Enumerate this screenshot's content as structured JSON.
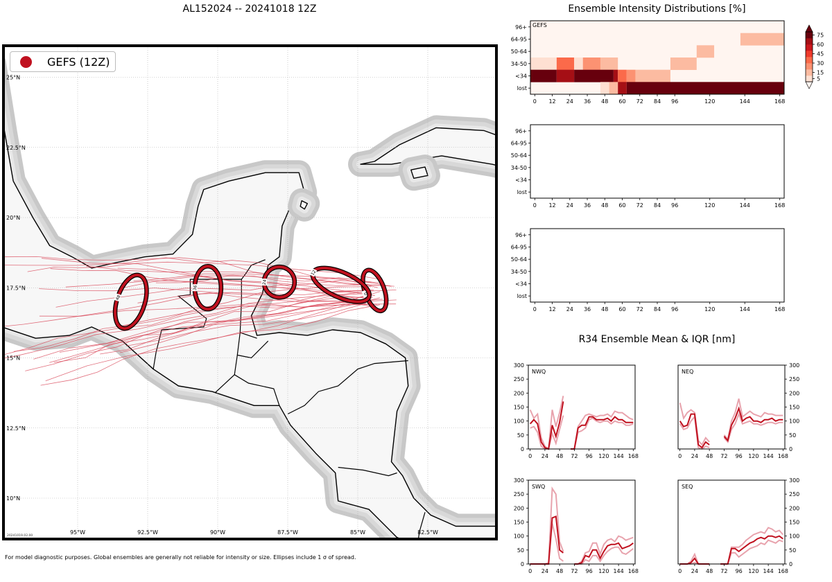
{
  "titles": {
    "main": "AL152024 -- 20241018 12Z",
    "heatmap": "Ensemble Intensity Distributions [%]",
    "r34": "R34 Ensemble Mean & IQR [nm]"
  },
  "legend": {
    "label": "GEFS (12Z)",
    "marker_color": "#c0111f"
  },
  "map": {
    "lat_labels": [
      "25°N",
      "22.5°N",
      "20°N",
      "17.5°N",
      "15°N",
      "12.5°N",
      "10°N"
    ],
    "lon_labels": [
      "95°W",
      "92.5°W",
      "90°W",
      "87.5°W",
      "85°W",
      "82.5°W"
    ],
    "timestamp_stamp": "20241019.02.00",
    "ellipses": [
      {
        "hour": "0",
        "lon": -84.4,
        "lat": 17.4
      },
      {
        "hour": "12",
        "lon": -85.6,
        "lat": 17.6
      },
      {
        "hour": "24",
        "lon": -87.8,
        "lat": 17.7
      },
      {
        "hour": "36",
        "lon": -90.35,
        "lat": 17.5
      },
      {
        "hour": "48",
        "lon": -93.1,
        "lat": 17.0
      }
    ]
  },
  "colorbar": {
    "ticks": [
      "75",
      "60",
      "45",
      "30",
      "15",
      "5"
    ],
    "colors": [
      "#fff5f0",
      "#fee0d2",
      "#fcbba1",
      "#fc9272",
      "#fb6a4a",
      "#ef3b2c",
      "#cb181d",
      "#a50f15",
      "#67000d"
    ]
  },
  "footer": "For model diagnostic purposes. Global ensembles are generally not reliable for intensity or size. Ellipses include 1 σ of spread.",
  "chart_data": [
    {
      "type": "heatmap",
      "panel_label": "GEFS",
      "y_categories": [
        "96+",
        "64-95",
        "50-64",
        "34-50",
        "<34",
        "lost"
      ],
      "x_ticks": [
        0,
        12,
        24,
        36,
        48,
        60,
        72,
        84,
        96,
        120,
        144,
        168
      ],
      "x_range": [
        -3,
        171
      ],
      "cells": [
        {
          "row": "64-95",
          "x0": 141,
          "x1": 171,
          "value": 15
        },
        {
          "row": "50-64",
          "x0": 111,
          "x1": 123,
          "value": 15
        },
        {
          "row": "34-50",
          "x0": -3,
          "x1": 15,
          "value": 5
        },
        {
          "row": "34-50",
          "x0": 15,
          "x1": 27,
          "value": 45
        },
        {
          "row": "34-50",
          "x0": 27,
          "x1": 33,
          "value": 5
        },
        {
          "row": "34-50",
          "x0": 33,
          "x1": 45,
          "value": 30
        },
        {
          "row": "34-50",
          "x0": 45,
          "x1": 57,
          "value": 15
        },
        {
          "row": "34-50",
          "x0": 93,
          "x1": 111,
          "value": 15
        },
        {
          "row": "<34",
          "x0": -3,
          "x1": 15,
          "value": 90
        },
        {
          "row": "<34",
          "x0": 15,
          "x1": 27,
          "value": 75
        },
        {
          "row": "<34",
          "x0": 27,
          "x1": 54,
          "value": 90
        },
        {
          "row": "<34",
          "x0": 54,
          "x1": 57,
          "value": 75
        },
        {
          "row": "<34",
          "x0": 57,
          "x1": 63,
          "value": 45
        },
        {
          "row": "<34",
          "x0": 63,
          "x1": 69,
          "value": 30
        },
        {
          "row": "<34",
          "x0": 69,
          "x1": 93,
          "value": 15
        },
        {
          "row": "lost",
          "x0": 45,
          "x1": 51,
          "value": 5
        },
        {
          "row": "lost",
          "x0": 51,
          "x1": 57,
          "value": 15
        },
        {
          "row": "lost",
          "x0": 57,
          "x1": 63,
          "value": 75
        },
        {
          "row": "lost",
          "x0": 63,
          "x1": 171,
          "value": 90
        }
      ]
    },
    {
      "type": "heatmap",
      "panel_label": "",
      "y_categories": [
        "96+",
        "64-95",
        "50-64",
        "34-50",
        "<34",
        "lost"
      ],
      "x_ticks": [
        0,
        12,
        24,
        36,
        48,
        60,
        72,
        84,
        96,
        120,
        144,
        168
      ],
      "x_range": [
        -3,
        171
      ],
      "cells": []
    },
    {
      "type": "heatmap",
      "panel_label": "",
      "y_categories": [
        "96+",
        "64-95",
        "50-64",
        "34-50",
        "<34",
        "lost"
      ],
      "x_ticks": [
        0,
        12,
        24,
        36,
        48,
        60,
        72,
        84,
        96,
        120,
        144,
        168
      ],
      "x_range": [
        -3,
        171
      ],
      "cells": []
    },
    {
      "type": "line",
      "quadrant": "NWQ",
      "xlim": [
        -3,
        171
      ],
      "ylim": [
        0,
        300
      ],
      "x_ticks": [
        0,
        24,
        48,
        72,
        96,
        120,
        144,
        168
      ],
      "y_ticks": [
        0,
        50,
        100,
        150,
        200,
        250,
        300
      ],
      "segments": [
        {
          "x": [
            0,
            6,
            12,
            18,
            24,
            30,
            36,
            42,
            48,
            54
          ],
          "mean": [
            90,
            105,
            90,
            25,
            5,
            0,
            85,
            45,
            95,
            170
          ],
          "q1": [
            75,
            80,
            60,
            10,
            0,
            0,
            55,
            20,
            70,
            120
          ],
          "q3": [
            140,
            110,
            125,
            40,
            10,
            0,
            140,
            80,
            130,
            190
          ]
        },
        {
          "x": [
            66,
            72,
            78,
            84,
            90,
            96,
            102,
            108,
            114,
            120,
            126,
            132,
            138,
            144,
            150,
            156,
            162,
            168
          ],
          "mean": [
            0,
            0,
            75,
            85,
            85,
            115,
            115,
            105,
            105,
            105,
            110,
            100,
            115,
            105,
            105,
            95,
            95,
            95
          ],
          "q1": [
            0,
            0,
            60,
            65,
            75,
            105,
            110,
            100,
            95,
            100,
            100,
            90,
            100,
            95,
            95,
            85,
            85,
            90
          ],
          "q3": [
            0,
            0,
            80,
            100,
            120,
            125,
            120,
            115,
            120,
            120,
            125,
            115,
            135,
            130,
            130,
            120,
            110,
            105
          ]
        }
      ]
    },
    {
      "type": "line",
      "quadrant": "NEQ",
      "xlim": [
        -3,
        171
      ],
      "ylim": [
        0,
        300
      ],
      "x_ticks": [
        0,
        24,
        48,
        72,
        96,
        120,
        144,
        168
      ],
      "y_ticks": [
        0,
        50,
        100,
        150,
        200,
        250,
        300
      ],
      "segments": [
        {
          "x": [
            0,
            6,
            12,
            18,
            24,
            30,
            36,
            42,
            48
          ],
          "mean": [
            100,
            80,
            85,
            125,
            125,
            15,
            5,
            25,
            15
          ],
          "q1": [
            90,
            70,
            75,
            100,
            115,
            5,
            0,
            10,
            5
          ],
          "q3": [
            165,
            110,
            130,
            140,
            130,
            30,
            15,
            40,
            25
          ]
        },
        {
          "x": [
            72,
            78,
            84,
            90,
            96,
            102,
            108,
            114,
            120,
            126,
            132,
            138,
            144,
            150,
            156,
            162,
            168
          ],
          "mean": [
            45,
            30,
            85,
            110,
            145,
            100,
            110,
            115,
            100,
            100,
            95,
            105,
            105,
            110,
            100,
            105,
            105
          ],
          "q1": [
            40,
            25,
            70,
            90,
            125,
            90,
            95,
            100,
            90,
            90,
            85,
            90,
            95,
            95,
            90,
            95,
            95
          ],
          "q3": [
            50,
            35,
            100,
            130,
            180,
            115,
            125,
            135,
            125,
            120,
            115,
            130,
            125,
            125,
            120,
            120,
            120
          ]
        }
      ]
    },
    {
      "type": "line",
      "quadrant": "SWQ",
      "xlim": [
        -3,
        171
      ],
      "ylim": [
        0,
        300
      ],
      "x_ticks": [
        0,
        24,
        48,
        72,
        96,
        120,
        144,
        168
      ],
      "y_ticks": [
        0,
        50,
        100,
        150,
        200,
        250,
        300
      ],
      "segments": [
        {
          "x": [
            0,
            6,
            12,
            18,
            24,
            30,
            36,
            42,
            48,
            54
          ],
          "mean": [
            0,
            0,
            0,
            0,
            0,
            0,
            165,
            170,
            50,
            40
          ],
          "q1": [
            0,
            0,
            0,
            0,
            0,
            0,
            145,
            90,
            20,
            10
          ],
          "q3": [
            0,
            0,
            0,
            0,
            0,
            5,
            270,
            250,
            80,
            45
          ]
        },
        {
          "x": [
            72,
            78,
            84,
            90,
            96,
            102,
            108,
            114,
            120,
            126,
            132,
            138,
            144,
            150,
            156,
            162,
            168
          ],
          "mean": [
            0,
            0,
            5,
            30,
            25,
            50,
            50,
            20,
            45,
            65,
            70,
            70,
            75,
            55,
            60,
            65,
            75
          ],
          "q1": [
            0,
            0,
            0,
            15,
            10,
            30,
            30,
            10,
            30,
            45,
            55,
            60,
            60,
            40,
            35,
            45,
            55
          ],
          "q3": [
            0,
            0,
            10,
            40,
            45,
            75,
            75,
            35,
            70,
            85,
            90,
            80,
            100,
            95,
            85,
            90,
            95
          ]
        }
      ]
    },
    {
      "type": "line",
      "quadrant": "SEQ",
      "xlim": [
        -3,
        171
      ],
      "ylim": [
        0,
        300
      ],
      "x_ticks": [
        0,
        24,
        48,
        72,
        96,
        120,
        144,
        168
      ],
      "y_ticks": [
        0,
        50,
        100,
        150,
        200,
        250,
        300
      ],
      "segments": [
        {
          "x": [
            0,
            6,
            12,
            18,
            24,
            30,
            36,
            42,
            48
          ],
          "mean": [
            0,
            0,
            0,
            5,
            20,
            0,
            0,
            0,
            0
          ],
          "q1": [
            0,
            0,
            0,
            0,
            5,
            0,
            0,
            0,
            0
          ],
          "q3": [
            0,
            0,
            0,
            10,
            35,
            0,
            0,
            0,
            0
          ]
        },
        {
          "x": [
            66,
            72,
            78,
            84,
            90,
            96,
            102,
            108,
            114,
            120,
            126,
            132,
            138,
            144,
            150,
            156,
            162,
            168
          ],
          "mean": [
            0,
            0,
            0,
            55,
            55,
            45,
            55,
            65,
            75,
            80,
            90,
            95,
            90,
            100,
            100,
            95,
            100,
            90
          ],
          "q1": [
            0,
            0,
            0,
            40,
            40,
            25,
            35,
            45,
            55,
            60,
            65,
            75,
            70,
            85,
            80,
            75,
            85,
            80
          ],
          "q3": [
            0,
            0,
            0,
            60,
            60,
            60,
            70,
            85,
            95,
            105,
            110,
            115,
            110,
            130,
            125,
            115,
            120,
            105
          ]
        }
      ]
    }
  ]
}
